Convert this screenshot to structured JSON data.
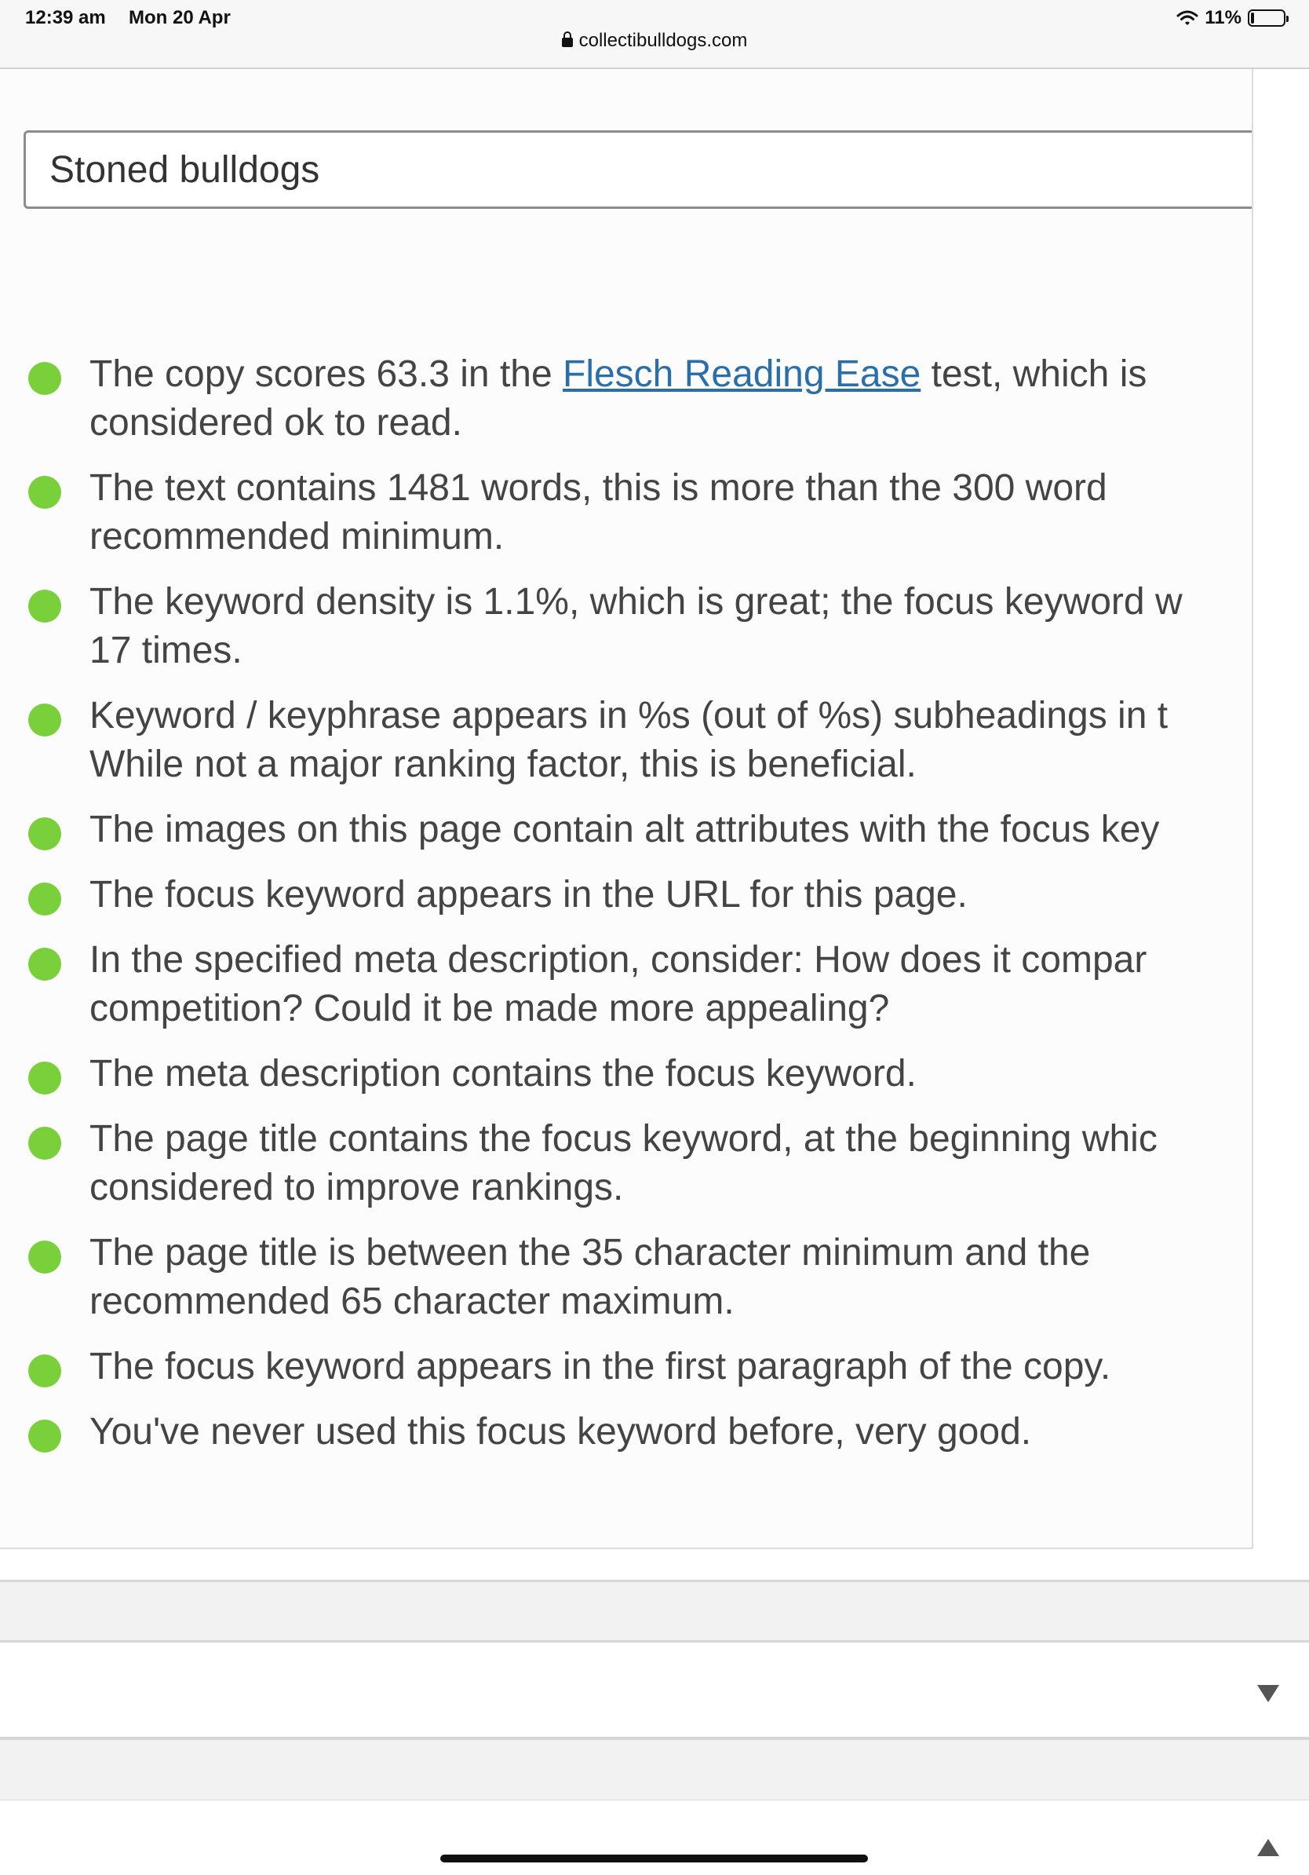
{
  "status_bar": {
    "time": "12:39 am",
    "date": "Mon 20 Apr",
    "battery": "11%",
    "battery_level": 0.11,
    "wifi_icon": "wifi-icon",
    "battery_icon": "battery-icon"
  },
  "address_bar": {
    "lock_icon": "lock-icon",
    "domain": "collectibulldogs.com"
  },
  "focus_keyword": {
    "value": "Stoned bulldogs"
  },
  "analysis": {
    "status_color": "#7ad03a",
    "link_color": "#2a6eaa",
    "items": [
      {
        "before": "The copy scores 63.3 in the ",
        "link": "Flesch Reading Ease",
        "after": " test, which is considered ok to read."
      },
      {
        "text": "The text contains 1481 words, this is more than the 300 word recommended minimum."
      },
      {
        "text": "The keyword density is 1.1%, which is great; the focus keyword w 17 times."
      },
      {
        "text": "Keyword / keyphrase appears in %s (out of %s) subheadings in t While not a major ranking factor, this is beneficial."
      },
      {
        "text": "The images on this page contain alt attributes with the focus key"
      },
      {
        "text": "The focus keyword appears in the URL for this page."
      },
      {
        "text": "In the specified meta description, consider: How does it compar competition? Could it be made more appealing?"
      },
      {
        "text": "The meta description contains the focus keyword."
      },
      {
        "text": "The page title contains the focus keyword, at the beginning whic considered to improve rankings."
      },
      {
        "text": "The page title is between the 35 character minimum and the recommended 65 character maximum."
      },
      {
        "text": "The focus keyword appears in the first paragraph of the copy."
      },
      {
        "text": "You've never used this focus keyword before, very good."
      }
    ]
  },
  "accordion": {
    "expand_icon": "caret-down-icon",
    "collapse_icon": "caret-up-icon"
  }
}
